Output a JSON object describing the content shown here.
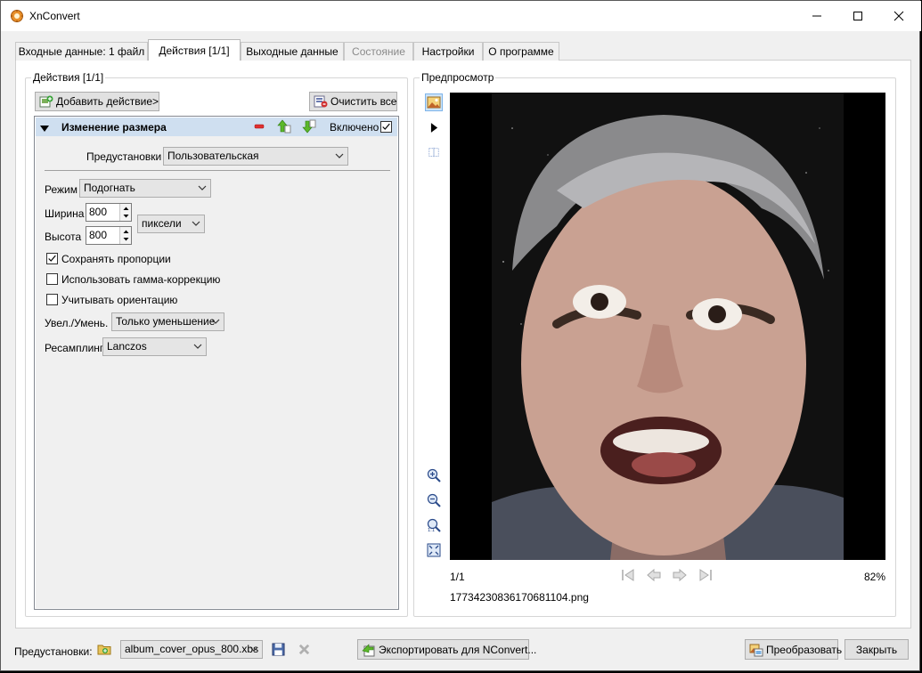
{
  "window": {
    "title": "XnConvert"
  },
  "tabs": [
    {
      "label": "Входные данные: 1 файл"
    },
    {
      "label": "Действия [1/1]"
    },
    {
      "label": "Выходные данные"
    },
    {
      "label": "Состояние"
    },
    {
      "label": "Настройки"
    },
    {
      "label": "О программе"
    }
  ],
  "actions": {
    "group_title": "Действия [1/1]",
    "add_button": "Добавить действие>",
    "clear_button": "Очистить все",
    "item": {
      "title": "Изменение размера",
      "enabled_label": "Включено",
      "enabled": true,
      "presets_label": "Предустановки",
      "presets_value": "Пользовательская",
      "mode_label": "Режим",
      "mode_value": "Подогнать",
      "width_label": "Ширина",
      "width_value": "800",
      "height_label": "Высота",
      "height_value": "800",
      "unit_value": "пиксели",
      "keep_ratio_label": "Сохранять пропорции",
      "keep_ratio": true,
      "gamma_label": "Использовать гамма-коррекцию",
      "gamma": false,
      "orientation_label": "Учитывать ориентацию",
      "orientation": false,
      "enlarge_label": "Увел./Умень.",
      "enlarge_value": "Только уменьшение",
      "resample_label": "Ресамплинг",
      "resample_value": "Lanczos"
    }
  },
  "preview": {
    "group_title": "Предпросмотр",
    "page_counter": "1/1",
    "zoom": "82%",
    "filename": "17734230836170681104.png"
  },
  "bottom": {
    "presets_label": "Предустановки:",
    "preset_file": "album_cover_opus_800.xbs",
    "export_button": "Экспортировать для NConvert...",
    "convert_button": "Преобразовать",
    "close_button": "Закрыть"
  }
}
